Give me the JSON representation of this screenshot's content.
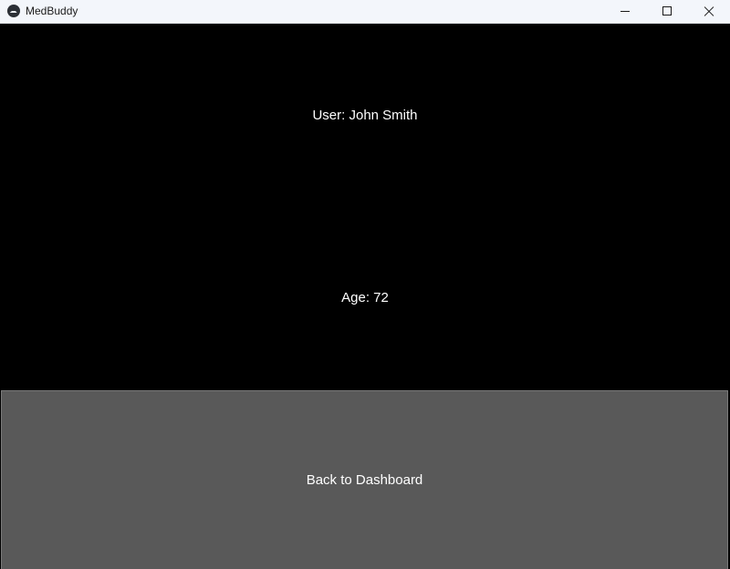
{
  "window": {
    "title": "MedBuddy",
    "app_icon": "medbuddy-logo-icon",
    "controls": [
      "minimize-icon",
      "maximize-icon",
      "close-icon"
    ]
  },
  "profile": {
    "user_text": "User: John Smith",
    "age_text": "Age: 72"
  },
  "actions": {
    "back_label": "Back to Dashboard"
  },
  "colors": {
    "background": "#000000",
    "titlebar": "#f3f6fb",
    "button_bg": "#595959",
    "text": "#ffffff"
  }
}
